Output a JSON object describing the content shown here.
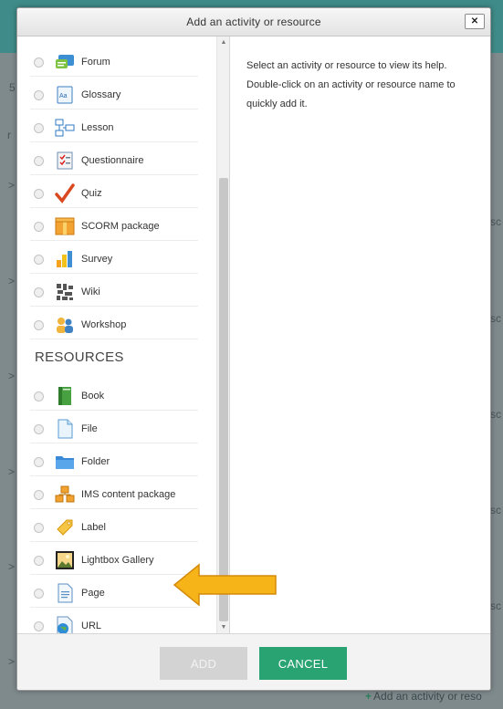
{
  "background": {
    "footer_link": "Add an activity or reso",
    "fragments": [
      "5",
      "r",
      "sc",
      "sc",
      "sc",
      "sc",
      "sc",
      ">",
      ">",
      ">",
      ">",
      ">",
      ">"
    ]
  },
  "dialog": {
    "title": "Add an activity or resource",
    "close_glyph": "✕",
    "help_text": "Select an activity or resource to view its help. Double-click on an activity or resource name to quickly add it.",
    "resources_heading": "RESOURCES"
  },
  "activities": [
    {
      "label": "Forum",
      "icon": "forum-icon"
    },
    {
      "label": "Glossary",
      "icon": "glossary-icon"
    },
    {
      "label": "Lesson",
      "icon": "lesson-icon"
    },
    {
      "label": "Questionnaire",
      "icon": "questionnaire-icon"
    },
    {
      "label": "Quiz",
      "icon": "quiz-icon"
    },
    {
      "label": "SCORM package",
      "icon": "scorm-package-icon"
    },
    {
      "label": "Survey",
      "icon": "survey-icon"
    },
    {
      "label": "Wiki",
      "icon": "wiki-icon"
    },
    {
      "label": "Workshop",
      "icon": "workshop-icon"
    }
  ],
  "resources": [
    {
      "label": "Book",
      "icon": "book-icon"
    },
    {
      "label": "File",
      "icon": "file-icon"
    },
    {
      "label": "Folder",
      "icon": "folder-icon"
    },
    {
      "label": "IMS content package",
      "icon": "ims-package-icon"
    },
    {
      "label": "Label",
      "icon": "label-icon"
    },
    {
      "label": "Lightbox Gallery",
      "icon": "lightbox-gallery-icon"
    },
    {
      "label": "Page",
      "icon": "page-icon"
    },
    {
      "label": "URL",
      "icon": "url-icon"
    }
  ],
  "buttons": {
    "add_label": "ADD",
    "cancel_label": "CANCEL"
  },
  "colors": {
    "cancel_green": "#2aa372",
    "add_disabled": "#d3d3d3",
    "arrow_orange": "#f7b419"
  }
}
